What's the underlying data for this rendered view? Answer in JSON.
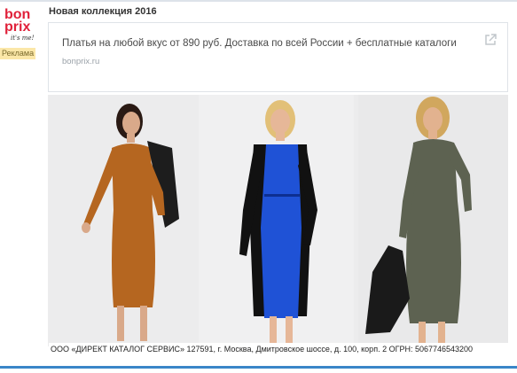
{
  "brand": {
    "logo_text_line1": "bon",
    "logo_text_line2": "prix",
    "logo_tagline": "it's me!",
    "colors": {
      "brand": "#e0213a",
      "accent": "#3a86c8"
    }
  },
  "ad": {
    "badge_label": "Реклама",
    "title": "Новая коллекция 2016",
    "headline": "Платья на любой вкус от 890 руб. Доставка по всей России + бесплатные каталоги",
    "domain": "bonprix.ru",
    "external_icon": "external-link-icon",
    "footer": "ООО «ДИРЕКТ КАТАЛОГ СЕРВИС» 127591, г. Москва, Дмитровское шоссе, д. 100, корп. 2 ОГРН: 5067746543200"
  }
}
